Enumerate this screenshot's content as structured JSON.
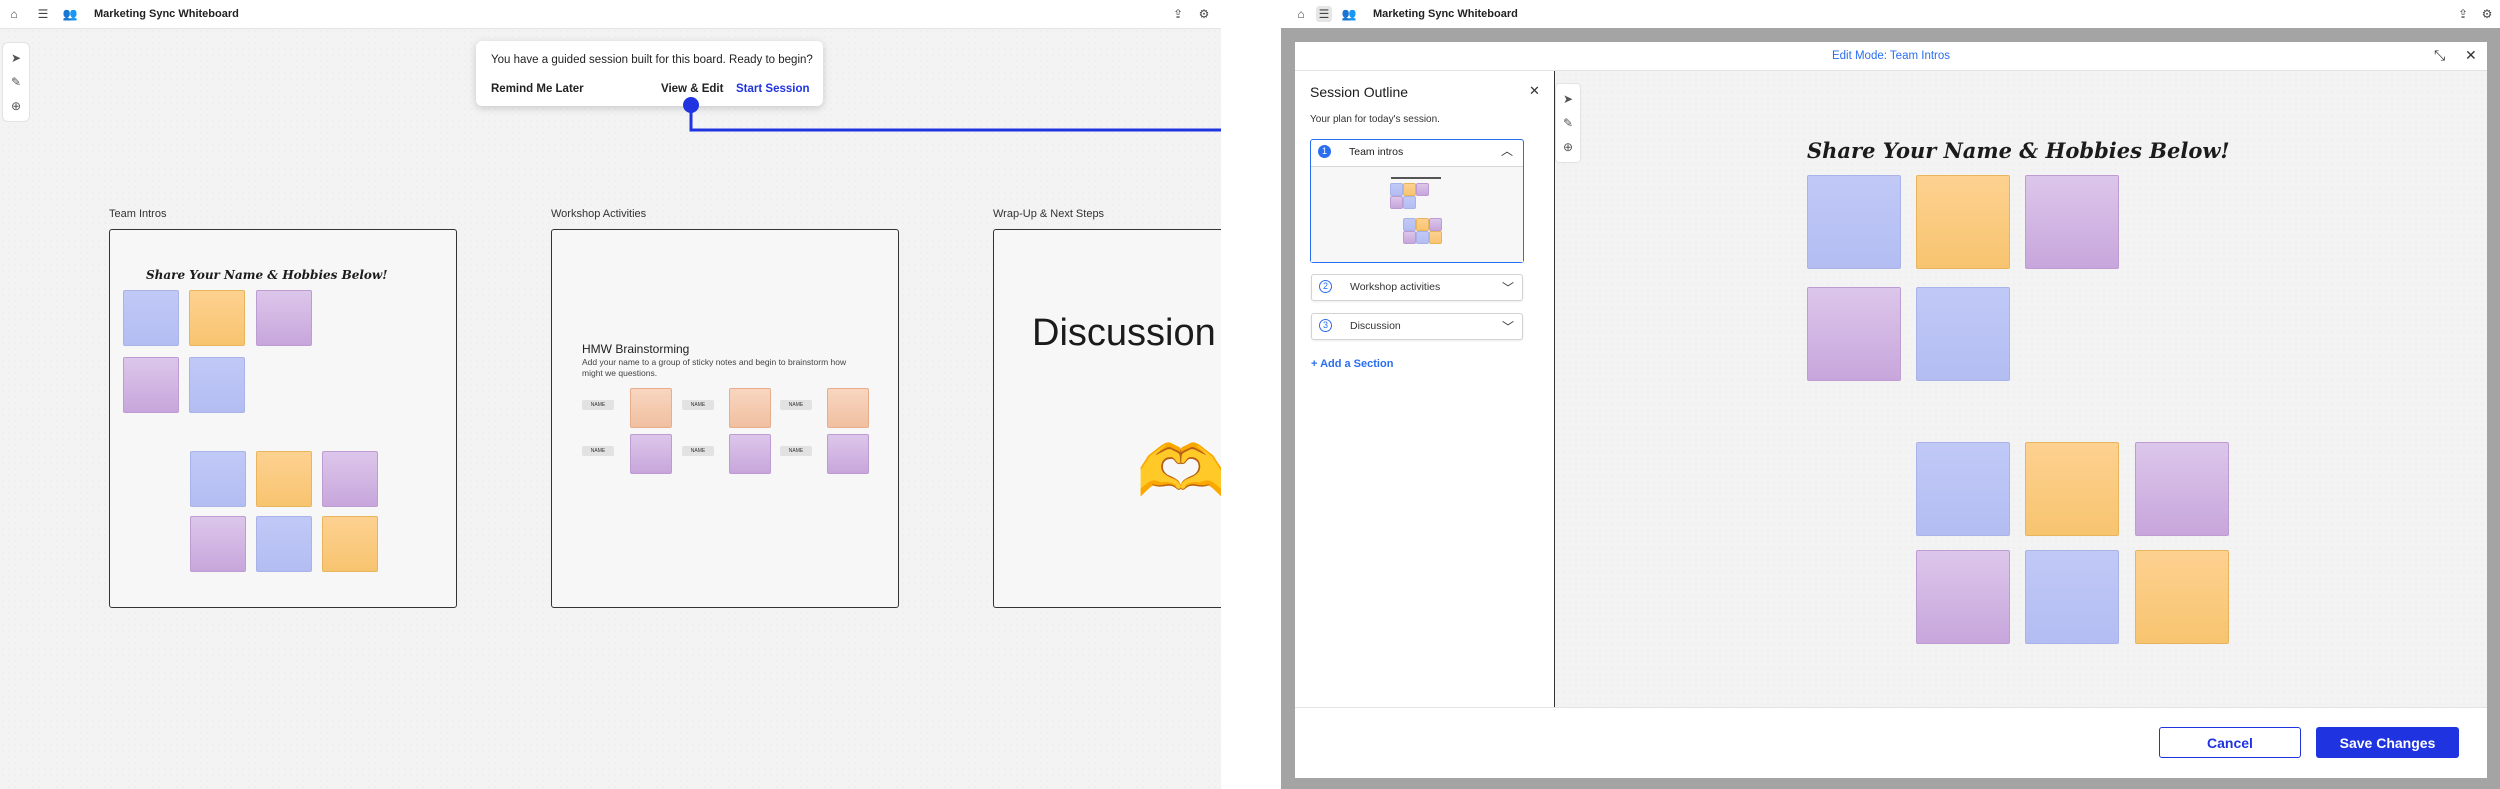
{
  "left_window": {
    "app_title": "Marketing Sync Whiteboard",
    "toolbar_icons": [
      "home-icon",
      "board-panel-icon",
      "people-icon",
      "share-icon",
      "gear-icon"
    ],
    "side_tools": [
      "pointer-icon",
      "pen-icon",
      "add-circle-icon"
    ]
  },
  "popup": {
    "message": "You have a guided session built for this board. Ready to begin?",
    "remind_label": "Remind Me Later",
    "view_edit_label": "View & Edit",
    "start_label": "Start Session"
  },
  "frames": [
    {
      "label": "Team Intros",
      "heading": "Share Your Name & Hobbies Below!"
    },
    {
      "label": "Workshop Activities",
      "heading": "HMW Brainstorming",
      "body": "Add your name to a group of sticky notes and begin to brainstorm how might we questions.",
      "pill_label": "NAME"
    },
    {
      "label": "Wrap-Up & Next Steps",
      "heading": "Discussion",
      "emoji": "🫶"
    }
  ],
  "right_window": {
    "app_title": "Marketing Sync Whiteboard",
    "dialog_title": "Edit Mode: Team Intros",
    "outline": {
      "title": "Session Outline",
      "subtitle": "Your plan for today's session.",
      "items": [
        {
          "num": "1",
          "label": "Team intros"
        },
        {
          "num": "2",
          "label": "Workshop activities"
        },
        {
          "num": "3",
          "label": "Discussion"
        }
      ],
      "add_label": "+ Add a Section"
    },
    "canvas_heading": "Share Your Name & Hobbies Below!",
    "cancel_label": "Cancel",
    "save_label": "Save Changes"
  },
  "colors": {
    "accent": "#1f34e0",
    "accent_light": "#2a6ef0",
    "sticky_blue": "#b8c2f4",
    "sticky_orange": "#f9c978",
    "sticky_purple": "#d0b0e2"
  }
}
